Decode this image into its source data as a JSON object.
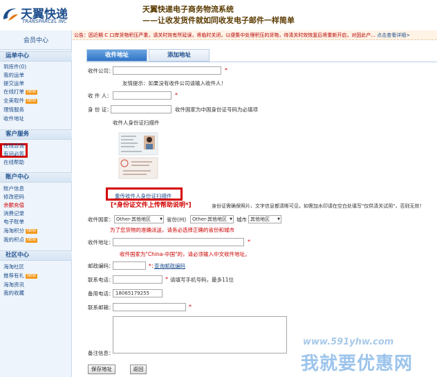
{
  "header": {
    "logo_cn": "天翼快递",
    "logo_en": "TRANSPARCEL INC",
    "slogan1": "天翼快递电子商务物流系统",
    "slogan2": "——让收发货件就如同收发电子邮件一样简单"
  },
  "sidebar": {
    "member": "会员中心",
    "sections": [
      {
        "title": "运单中心",
        "items": [
          {
            "label": "到库件(0)",
            "tag": ""
          },
          {
            "label": "我的运单",
            "tag": ""
          },
          {
            "label": "提交运单",
            "tag": ""
          },
          {
            "label": "在线打单",
            "tag": "NEW"
          },
          {
            "label": "全美取件",
            "tag": "NEW"
          },
          {
            "label": "理情服务",
            "tag": ""
          },
          {
            "label": "收件地址",
            "tag": ""
          }
        ]
      },
      {
        "title": "客户服务",
        "items": [
          {
            "label": "在线咨询",
            "tag": ""
          },
          {
            "label": "有问必答",
            "tag": ""
          },
          {
            "label": "在线帮助",
            "tag": ""
          }
        ]
      },
      {
        "title": "账户中心",
        "items": [
          {
            "label": "账户信息",
            "tag": ""
          },
          {
            "label": "修改密码",
            "tag": ""
          },
          {
            "label": "余额充值",
            "tag": "",
            "red": true
          },
          {
            "label": "消费记录",
            "tag": ""
          },
          {
            "label": "电子账单",
            "tag": ""
          },
          {
            "label": "海淘积分",
            "tag": "NEW"
          },
          {
            "label": "我的积点",
            "tag": "NEW"
          }
        ]
      },
      {
        "title": "社区中心",
        "items": [
          {
            "label": "海淘社区",
            "tag": ""
          },
          {
            "label": "推荐有礼",
            "tag": "NEW"
          },
          {
            "label": "海淘资讯",
            "tag": ""
          },
          {
            "label": "我的收藏",
            "tag": ""
          }
        ]
      }
    ]
  },
  "notice": {
    "text": "公告：因近期 C 口岸货物积压严重，请关时效有所延误，将临时关闭，以便集中处理积压的货物，待清关时效恢复后将重新开启，对因此产...",
    "link": "点击查看详细>"
  },
  "tabs": [
    "收件地址",
    "添加地址"
  ],
  "form": {
    "company_label": "收件公司：",
    "company_tip": "友情提示：如果没有收件公司请输入收件人！",
    "recipient_label": "收 件 人：",
    "idcard_label": "身 份 证：",
    "idcard_tip": "收件国家为中国身份证号码为必填项",
    "scan_label": "收件人身份证扫描件",
    "reupload": "重传收件人身份证扫描件",
    "upload_help": "[*身份证文件上传帮助说明*]",
    "upload_note": "身份证需确保照片、文字信息都清晰可见，如需加水印请在空白处填写\"仅供清关试用\"，否则无效！",
    "country_label": "收件国家：",
    "country_value": "Other-其他地区",
    "province_label": "省份(州)",
    "province_value": "Other-其他地区",
    "city_label": "城市",
    "city_value": "其他地区",
    "region_tip": "为了您货物的准确派送，请务必选择正确的省份和城市",
    "address_label": "收件地址：",
    "address_tip": "收件国家为\"China-中国\"的，请必须输入中文收件地址。",
    "zip_label": "邮政编码：",
    "zip_link": "查询邮政编码",
    "phone_label": "联系电话：",
    "phone_tip": "请填写手机号码，最多11位",
    "backup_label": "备用电话：",
    "backup_value": "18065179255",
    "email_label": "联系邮箱：",
    "remark_label": "备注信息：",
    "save_button": "保存地址",
    "back_button": "返回",
    "required_mark": "*",
    "colon_star": "*："
  },
  "watermark": {
    "url": "www.591yhw.com",
    "text": "我就要优惠网"
  }
}
